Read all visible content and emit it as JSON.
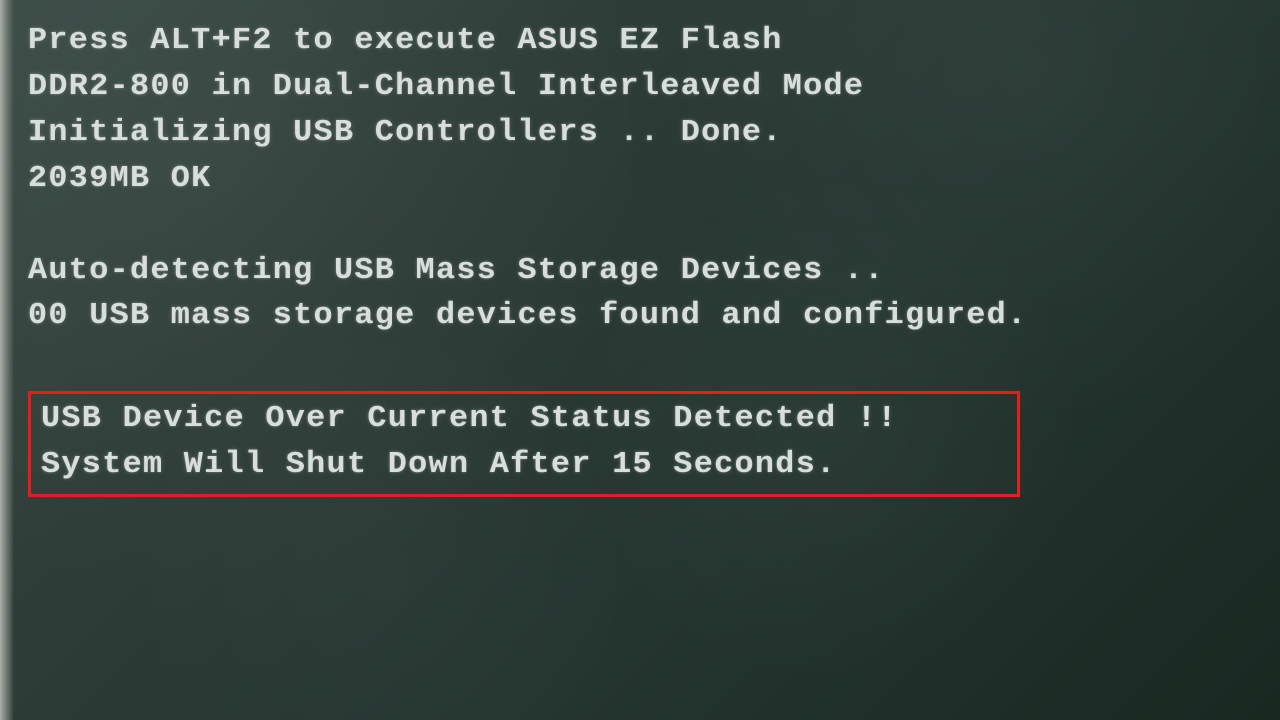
{
  "bios": {
    "line1": "Press ALT+F2 to execute ASUS EZ Flash",
    "line2": "DDR2-800 in Dual-Channel Interleaved Mode",
    "line3": "Initializing USB Controllers .. Done.",
    "line4": "2039MB OK",
    "line5": "Auto-detecting USB Mass Storage Devices ..",
    "line6": "00 USB mass storage devices found and configured.",
    "error": {
      "line1": "USB Device Over Current Status Detected !!",
      "line2": "System Will Shut Down After 15 Seconds."
    }
  }
}
